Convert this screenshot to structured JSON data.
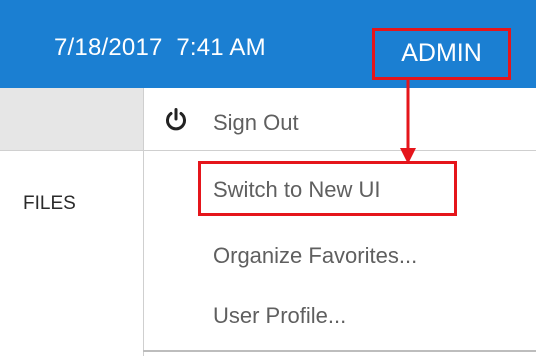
{
  "header": {
    "date": "7/18/2017",
    "time": "7:41 AM",
    "user_button": "ADMIN"
  },
  "sidebar": {
    "files_label": "FILES"
  },
  "user_menu": {
    "sign_out_label": "Sign Out",
    "sign_out_icon": "power-icon",
    "items": [
      {
        "label": "Switch to New UI"
      },
      {
        "label": "Organize Favorites..."
      },
      {
        "label": "User Profile..."
      }
    ]
  },
  "annotation_color": "#e5151b",
  "topbar_color": "#1b7fd2"
}
